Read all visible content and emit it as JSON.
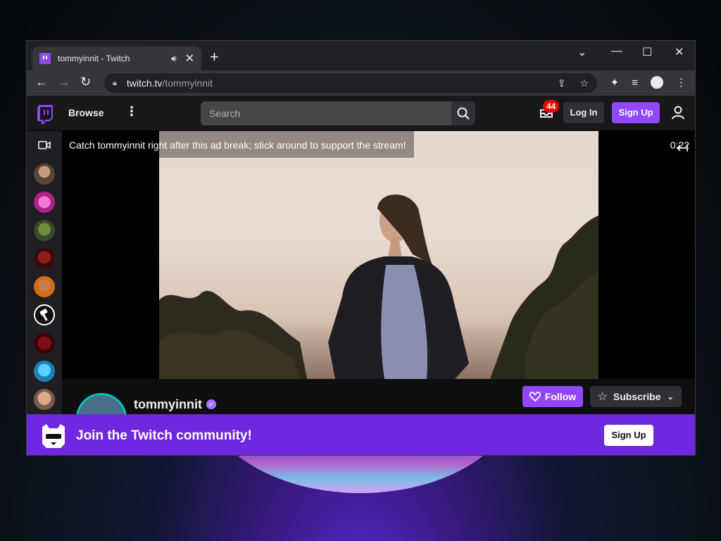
{
  "browser": {
    "tab_title": "tommyinnit - Twitch",
    "url_host": "twitch.tv",
    "url_path": "/tommyinnit"
  },
  "header": {
    "browse_label": "Browse",
    "search_placeholder": "Search",
    "inbox_badge": "44",
    "login_label": "Log In",
    "signup_label": "Sign Up"
  },
  "player": {
    "ad_message": "Catch tommyinnit right after this ad break; stick around to support the stream!",
    "ad_timer": "0:22"
  },
  "channel": {
    "name": "tommyinnit",
    "follow_label": "Follow",
    "subscribe_label": "Subscribe"
  },
  "banner": {
    "text": "Join the Twitch community!",
    "signup_label": "Sign Up"
  },
  "colors": {
    "brand": "#9147ff",
    "banner": "#6f28e0",
    "badge": "#eb0400"
  }
}
